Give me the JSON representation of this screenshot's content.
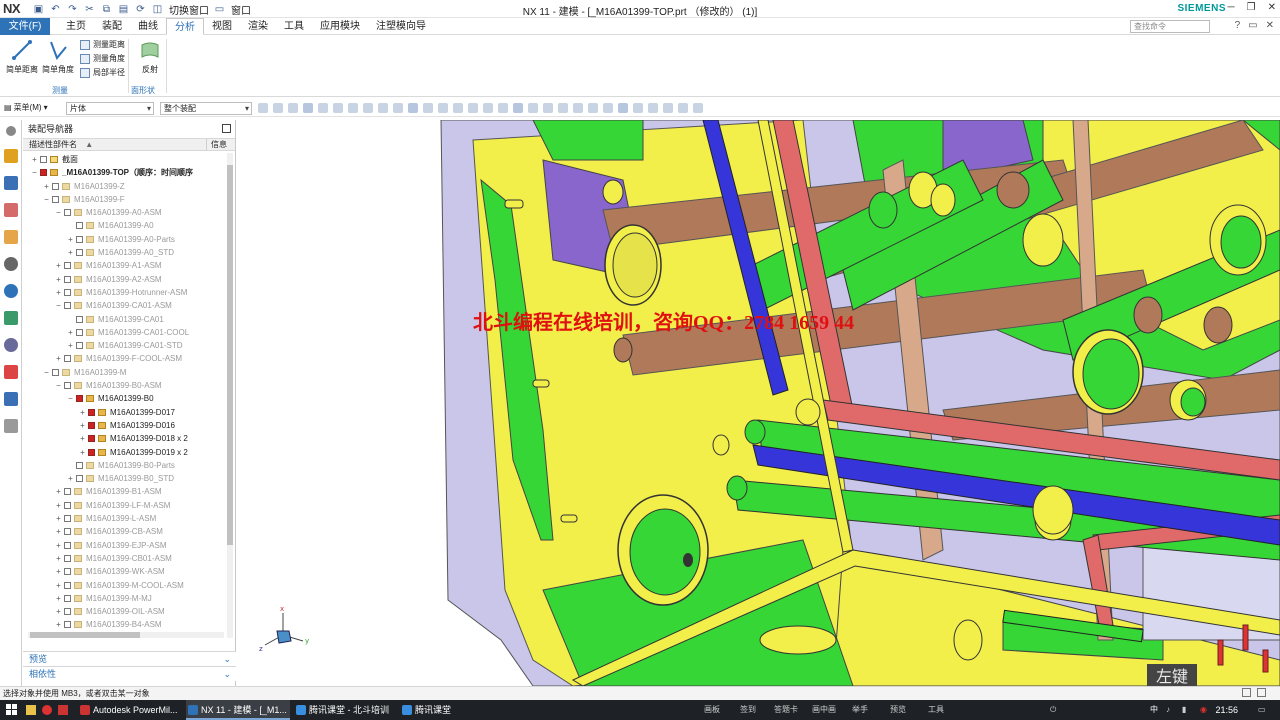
{
  "titlebar": {
    "logo": "NX",
    "switch_window": "切换窗口",
    "window": "窗口",
    "title": "NX 11 - 建模 - [_M16A01399-TOP.prt  （修改的）  (1)]",
    "brand": "SIEMENS"
  },
  "tabs": {
    "file": "文件(F)",
    "items": [
      "主页",
      "装配",
      "曲线",
      "分析",
      "视图",
      "渲染",
      "工具",
      "应用模块",
      "注塑模向导"
    ],
    "active": "分析",
    "search_placeholder": "查找命令"
  },
  "ribbon": {
    "big": [
      "简单距离",
      "简单角度"
    ],
    "small": [
      "测量距离",
      "测量角度",
      "局部半径"
    ],
    "reflect": "反射",
    "groups": [
      "测量",
      "面形状"
    ]
  },
  "toolbar": {
    "menu": "菜单(M)",
    "filter": "片体",
    "scope": "整个装配"
  },
  "navigator": {
    "title": "装配导航器",
    "col_name": "描述性部件名",
    "col_info": "信息",
    "rows": [
      {
        "lvl": 0,
        "tg": "+",
        "txt": "截面",
        "state": "folder",
        "dim": false
      },
      {
        "lvl": 0,
        "tg": "−",
        "txt": "_M16A01399-TOP（顺序：时间顺序",
        "state": "on",
        "dim": false,
        "bold": true
      },
      {
        "lvl": 1,
        "tg": "+",
        "txt": "M16A01399-Z",
        "state": "off",
        "dim": true
      },
      {
        "lvl": 1,
        "tg": "−",
        "txt": "M16A01399-F",
        "state": "off",
        "dim": true
      },
      {
        "lvl": 2,
        "tg": "−",
        "txt": "M16A01399-A0-ASM",
        "state": "off",
        "dim": true
      },
      {
        "lvl": 3,
        "tg": "",
        "txt": "M16A01399-A0",
        "state": "off",
        "dim": true
      },
      {
        "lvl": 3,
        "tg": "+",
        "txt": "M16A01399-A0-Parts",
        "state": "off",
        "dim": true
      },
      {
        "lvl": 3,
        "tg": "+",
        "txt": "M16A01399-A0_STD",
        "state": "off",
        "dim": true
      },
      {
        "lvl": 2,
        "tg": "+",
        "txt": "M16A01399-A1-ASM",
        "state": "off",
        "dim": true
      },
      {
        "lvl": 2,
        "tg": "+",
        "txt": "M16A01399-A2-ASM",
        "state": "off",
        "dim": true
      },
      {
        "lvl": 2,
        "tg": "+",
        "txt": "M16A01399-Hotrunner-ASM",
        "state": "off",
        "dim": true
      },
      {
        "lvl": 2,
        "tg": "−",
        "txt": "M16A01399-CA01-ASM",
        "state": "off",
        "dim": true
      },
      {
        "lvl": 3,
        "tg": "",
        "txt": "M16A01399-CA01",
        "state": "off",
        "dim": true
      },
      {
        "lvl": 3,
        "tg": "+",
        "txt": "M16A01399-CA01-COOL",
        "state": "off",
        "dim": true
      },
      {
        "lvl": 3,
        "tg": "+",
        "txt": "M16A01399-CA01-STD",
        "state": "off",
        "dim": true
      },
      {
        "lvl": 2,
        "tg": "+",
        "txt": "M16A01399-F-COOL-ASM",
        "state": "off",
        "dim": true
      },
      {
        "lvl": 1,
        "tg": "−",
        "txt": "M16A01399-M",
        "state": "off",
        "dim": true
      },
      {
        "lvl": 2,
        "tg": "−",
        "txt": "M16A01399-B0-ASM",
        "state": "off",
        "dim": true
      },
      {
        "lvl": 3,
        "tg": "−",
        "txt": "M16A01399-B0",
        "state": "on",
        "dim": false
      },
      {
        "lvl": 4,
        "tg": "+",
        "txt": "M16A01399-D017",
        "state": "on",
        "dim": false
      },
      {
        "lvl": 4,
        "tg": "+",
        "txt": "M16A01399-D016",
        "state": "on",
        "dim": false
      },
      {
        "lvl": 4,
        "tg": "+",
        "txt": "M16A01399-D018 x 2",
        "state": "on",
        "dim": false
      },
      {
        "lvl": 4,
        "tg": "+",
        "txt": "M16A01399-D019 x 2",
        "state": "on",
        "dim": false
      },
      {
        "lvl": 3,
        "tg": "",
        "txt": "M16A01399-B0-Parts",
        "state": "off",
        "dim": true
      },
      {
        "lvl": 3,
        "tg": "+",
        "txt": "M16A01399-B0_STD",
        "state": "off",
        "dim": true
      },
      {
        "lvl": 2,
        "tg": "+",
        "txt": "M16A01399-B1-ASM",
        "state": "off",
        "dim": true
      },
      {
        "lvl": 2,
        "tg": "+",
        "txt": "M16A01399-LF-M-ASM",
        "state": "off",
        "dim": true
      },
      {
        "lvl": 2,
        "tg": "+",
        "txt": "M16A01399-L-ASM",
        "state": "off",
        "dim": true
      },
      {
        "lvl": 2,
        "tg": "+",
        "txt": "M16A01399-CB-ASM",
        "state": "off",
        "dim": true
      },
      {
        "lvl": 2,
        "tg": "+",
        "txt": "M16A01399-EJP-ASM",
        "state": "off",
        "dim": true
      },
      {
        "lvl": 2,
        "tg": "+",
        "txt": "M16A01399-CB01-ASM",
        "state": "off",
        "dim": true
      },
      {
        "lvl": 2,
        "tg": "+",
        "txt": "M16A01399-WK-ASM",
        "state": "off",
        "dim": true
      },
      {
        "lvl": 2,
        "tg": "+",
        "txt": "M16A01399-M-COOL-ASM",
        "state": "off",
        "dim": true
      },
      {
        "lvl": 2,
        "tg": "+",
        "txt": "M16A01399-M-MJ",
        "state": "off",
        "dim": true
      },
      {
        "lvl": 2,
        "tg": "+",
        "txt": "M16A01399-OIL-ASM",
        "state": "off",
        "dim": true
      },
      {
        "lvl": 2,
        "tg": "+",
        "txt": "M16A01399-B4-ASM",
        "state": "off",
        "dim": true
      }
    ],
    "preview": "预览",
    "dependency": "相依性"
  },
  "viewport": {
    "watermark": "北斗编程在线培训，咨询QQ：2784 1659 44",
    "leftkey": "左键"
  },
  "status": {
    "text": "选择对象并使用 MB3，或者双击某一对象"
  },
  "taskbar": {
    "apps": [
      "Autodesk PowerMil...",
      "NX 11 - 建模 - [_M1...",
      "腾讯课堂 - 北斗培训",
      "腾讯课堂"
    ],
    "tray": [
      "画板",
      "签到",
      "答题卡",
      "画中画",
      "举手",
      "预览",
      "工具"
    ],
    "ime": "中",
    "clock": "21:56"
  },
  "colors": {
    "accent": "#2e73b8",
    "brand": "#00999a",
    "yellow": "#f2ee4a",
    "green": "#35d635",
    "pink": "#e06a6a",
    "blue": "#3535d9",
    "brown": "#b07a5a",
    "lavender": "#c9c6ea",
    "watermark": "#e01010"
  }
}
